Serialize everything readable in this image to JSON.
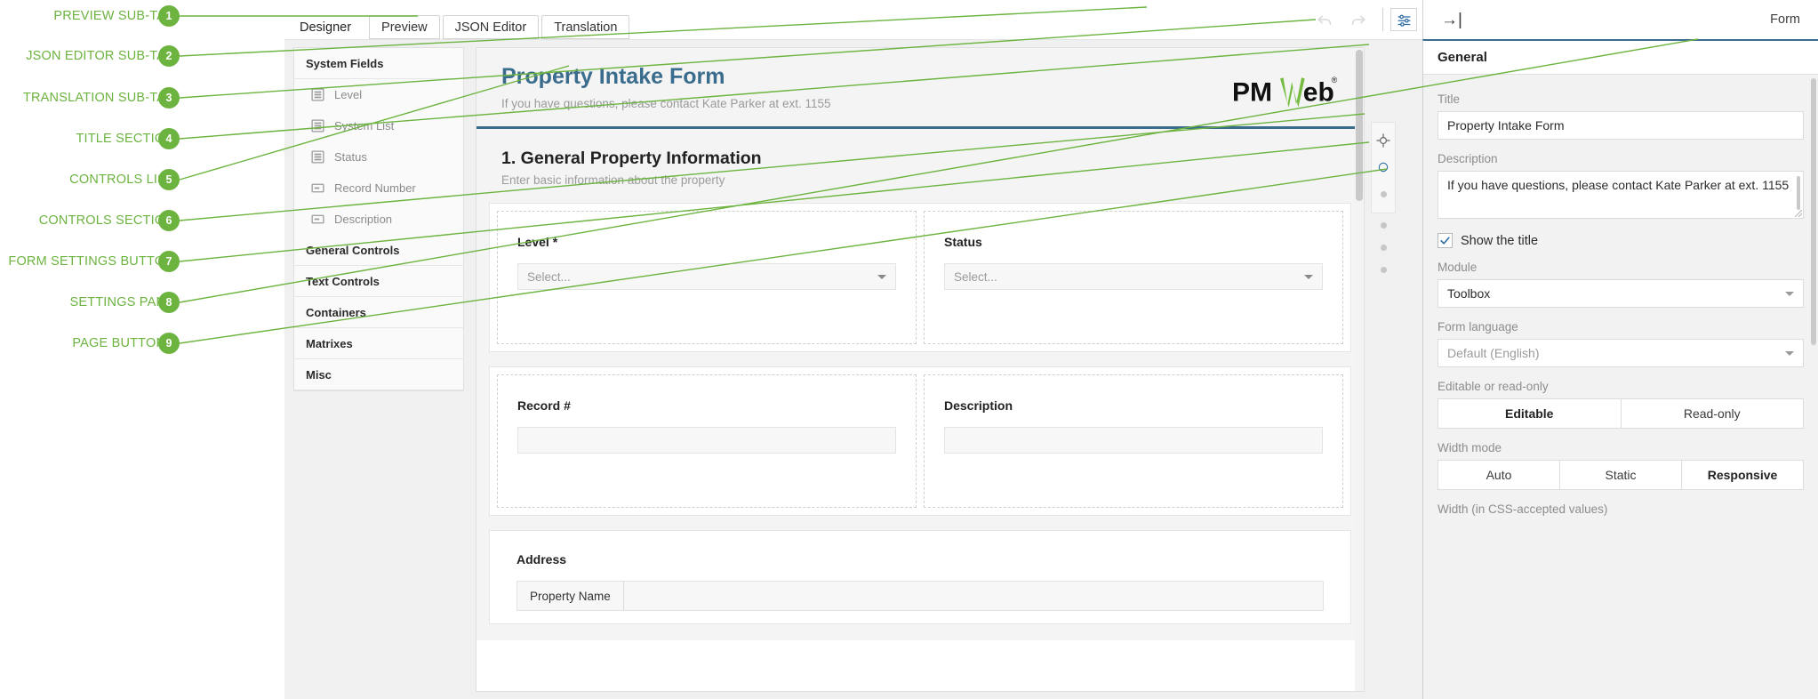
{
  "callouts": [
    {
      "n": "1",
      "label": "PREVIEW SUB-TAB"
    },
    {
      "n": "2",
      "label": "JSON EDITOR SUB-TAB"
    },
    {
      "n": "3",
      "label": "TRANSLATION SUB-TAB"
    },
    {
      "n": "4",
      "label": "TITLE SECTION"
    },
    {
      "n": "5",
      "label": "CONTROLS LIST"
    },
    {
      "n": "6",
      "label": "CONTROLS SECTION"
    },
    {
      "n": "7",
      "label": "FORM SETTINGS BUTTON"
    },
    {
      "n": "8",
      "label": "SETTINGS PANE"
    },
    {
      "n": "9",
      "label": "PAGE BUTTONS"
    }
  ],
  "colors": {
    "annotation_green": "#6cb33f",
    "title_blue": "#3a6c8e",
    "icon_blue": "#2e6ca4",
    "logo_green": "#76bc43"
  },
  "tabbar": {
    "tabs": [
      {
        "label": "Designer",
        "active": true
      },
      {
        "label": "Preview",
        "active": false
      },
      {
        "label": "JSON Editor",
        "active": false
      },
      {
        "label": "Translation",
        "active": false
      }
    ],
    "undo_icon": "undo-icon",
    "redo_icon": "redo-icon",
    "settings_icon": "sliders-icon"
  },
  "right_header": {
    "collapse_icon": "collapse-right-icon",
    "collapse_glyph": "→|",
    "title": "Form"
  },
  "controls_list": {
    "groups": [
      {
        "title": "System Fields",
        "expanded": true,
        "items": [
          {
            "label": "Level",
            "icon": "list-control-icon"
          },
          {
            "label": "System List",
            "icon": "list-control-icon"
          },
          {
            "label": "Status",
            "icon": "list-control-icon"
          },
          {
            "label": "Record Number",
            "icon": "text-control-icon"
          },
          {
            "label": "Description",
            "icon": "text-control-icon"
          }
        ]
      },
      {
        "title": "General Controls",
        "expanded": false,
        "items": []
      },
      {
        "title": "Text Controls",
        "expanded": false,
        "items": []
      },
      {
        "title": "Containers",
        "expanded": false,
        "items": []
      },
      {
        "title": "Matrixes",
        "expanded": false,
        "items": []
      },
      {
        "title": "Misc",
        "expanded": false,
        "items": []
      }
    ]
  },
  "canvas": {
    "form_title": "Property Intake Form",
    "form_subtitle": "If you have questions, please contact Kate Parker at ext. 1155",
    "logo": {
      "text_left": "PM",
      "text_right": "eb",
      "registered": "®",
      "name": "pmweb-logo"
    },
    "section": {
      "title": "1. General Property Information",
      "subtitle": "Enter basic information about the property"
    },
    "fields": [
      {
        "label": "Level *",
        "type": "select",
        "placeholder": "Select..."
      },
      {
        "label": "Status",
        "type": "select",
        "placeholder": "Select..."
      },
      {
        "label": "Record #",
        "type": "text",
        "placeholder": ""
      },
      {
        "label": "Description",
        "type": "text",
        "placeholder": ""
      }
    ],
    "address": {
      "label": "Address",
      "first_cell": "Property Name"
    },
    "mini_toolbar": {
      "buttons": [
        {
          "icon": "move-target-icon"
        },
        {
          "icon": "circle-icon"
        }
      ],
      "dots": 4
    }
  },
  "settings": {
    "header": "General",
    "title_label": "Title",
    "title_value": "Property Intake Form",
    "description_label": "Description",
    "description_value": "If you have questions, please contact Kate Parker at ext. 1155",
    "show_title_label": "Show the title",
    "show_title_checked": true,
    "module_label": "Module",
    "module_value": "Toolbox",
    "language_label": "Form language",
    "language_value": "Default (English)",
    "editable_label": "Editable or read-only",
    "editable_options": [
      {
        "label": "Editable",
        "selected": true
      },
      {
        "label": "Read-only",
        "selected": false
      }
    ],
    "width_mode_label": "Width mode",
    "width_mode_options": [
      {
        "label": "Auto",
        "selected": false
      },
      {
        "label": "Static",
        "selected": false
      },
      {
        "label": "Responsive",
        "selected": true
      }
    ],
    "width_css_label": "Width (in CSS-accepted values)"
  }
}
